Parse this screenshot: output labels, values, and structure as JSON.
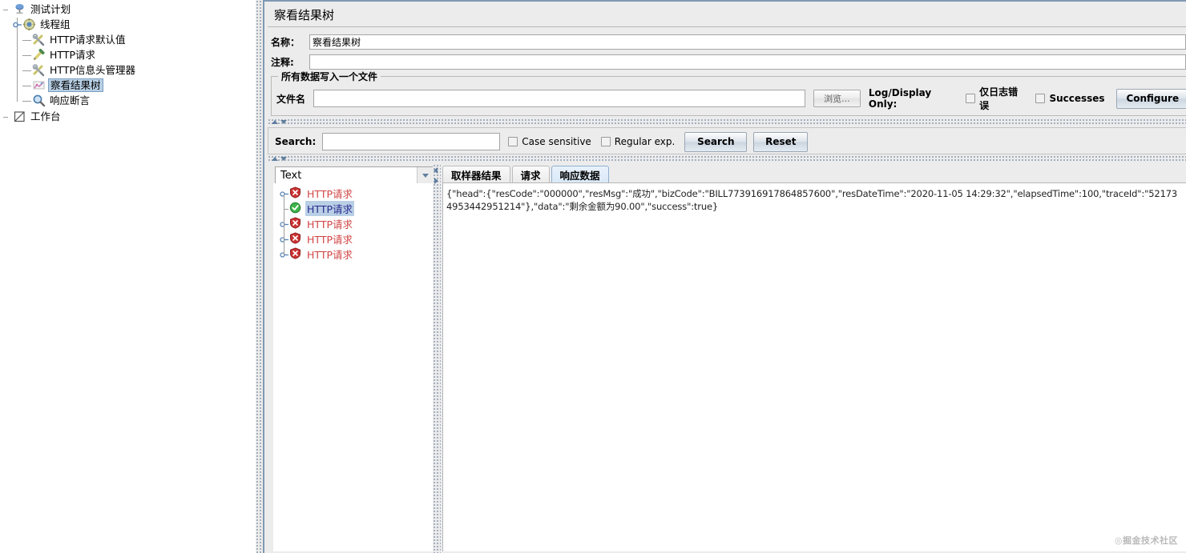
{
  "test_plan_tree": {
    "nodes": [
      {
        "label": "测试计划",
        "icon": "test-plan-icon",
        "depth": 0,
        "selected": false
      },
      {
        "label": "线程组",
        "icon": "thread-group-icon",
        "depth": 1,
        "selected": false
      },
      {
        "label": "HTTP请求默认值",
        "icon": "http-defaults-icon",
        "depth": 2,
        "selected": false
      },
      {
        "label": "HTTP请求",
        "icon": "http-sampler-icon",
        "depth": 2,
        "selected": false
      },
      {
        "label": "HTTP信息头管理器",
        "icon": "header-manager-icon",
        "depth": 2,
        "selected": false
      },
      {
        "label": "察看结果树",
        "icon": "view-results-tree-icon",
        "depth": 2,
        "selected": true
      },
      {
        "label": "响应断言",
        "icon": "response-assertion-icon",
        "depth": 2,
        "selected": false
      },
      {
        "label": "工作台",
        "icon": "workbench-icon",
        "depth": 0,
        "selected": false
      }
    ]
  },
  "panel": {
    "title": "察看结果树",
    "name_label": "名称：",
    "name_value": "察看结果树",
    "comment_label": "注释:",
    "comment_value": ""
  },
  "file_group": {
    "title": "所有数据写入一个文件",
    "filename_label": "文件名",
    "filename_value": "",
    "browse_button": "浏览...",
    "log_display_only_label": "Log/Display Only:",
    "errors_checkbox": "仅日志错误",
    "errors_checked": false,
    "successes_checkbox": "Successes",
    "successes_checked": false,
    "configure_button": "Configure"
  },
  "search": {
    "label": "Search:",
    "value": "",
    "case_sensitive_label": "Case sensitive",
    "case_sensitive_checked": false,
    "regular_exp_label": "Regular exp.",
    "regular_exp_checked": false,
    "search_button": "Search",
    "reset_button": "Reset"
  },
  "render_combo": {
    "selected": "Text",
    "arrow": "chevron-down-icon"
  },
  "results_tree": {
    "items": [
      {
        "label": "HTTP请求",
        "status": "error",
        "selected": false,
        "expandable": true
      },
      {
        "label": "HTTP请求",
        "status": "success",
        "selected": true,
        "expandable": false
      },
      {
        "label": "HTTP请求",
        "status": "error",
        "selected": false,
        "expandable": true
      },
      {
        "label": "HTTP请求",
        "status": "error",
        "selected": false,
        "expandable": true
      },
      {
        "label": "HTTP请求",
        "status": "error",
        "selected": false,
        "expandable": true
      }
    ]
  },
  "tabs": [
    {
      "label": "取样器结果",
      "active": false
    },
    {
      "label": "请求",
      "active": false
    },
    {
      "label": "响应数据",
      "active": true
    }
  ],
  "response": {
    "text": "{\"head\":{\"resCode\":\"000000\",\"resMsg\":\"成功\",\"bizCode\":\"BILL773916917864857600\",\"resDateTime\":\"2020-11-05 14:29:32\",\"elapsedTime\":100,\"traceId\":\"521734953442951214\"},\"data\":\"剩余金额为90.00\",\"success\":true}"
  },
  "watermark": {
    "text": "◎掘金技术社区"
  },
  "colors": {
    "panel_bg": "#ececed",
    "selection_blue": "#b8cfe5",
    "error_red": "#d14444",
    "success_green": "#2f9e44",
    "border": "#7f99b2"
  }
}
